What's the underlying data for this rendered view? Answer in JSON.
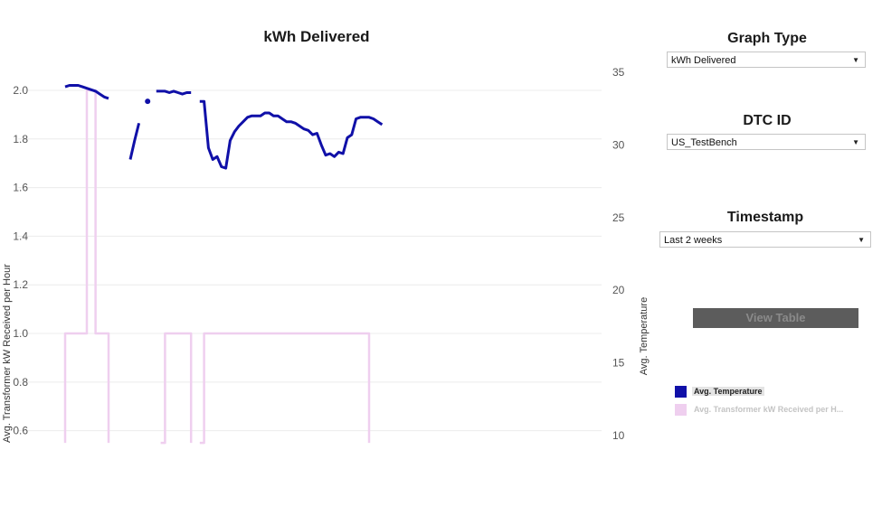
{
  "chart_data": {
    "type": "line",
    "title": "kWh Delivered",
    "ylabel_left": "Avg. Transformer kW Received per Hour",
    "ylabel_right": "Avg. Temperature",
    "y_left_ticks": [
      "2.0",
      "1.8",
      "1.6",
      "1.4",
      "1.2",
      "1.0",
      "0.8",
      "0.6"
    ],
    "y_right_ticks": [
      "35",
      "30",
      "25",
      "20",
      "15",
      "10"
    ],
    "y_left_range": [
      0.58,
      2.0
    ],
    "y_right_range": [
      10,
      35
    ],
    "grid": true,
    "series": [
      {
        "name": "Avg. Transformer kW Received per Hour",
        "axis": "left",
        "color": "#efcfef",
        "segments": [
          [
            [
              0,
              0.55
            ],
            [
              0,
              1.0
            ],
            [
              1,
              1.0
            ],
            [
              2,
              1.0
            ],
            [
              3,
              1.0
            ],
            [
              4,
              1.0
            ],
            [
              5,
              2.0
            ],
            [
              6,
              2.0
            ],
            [
              7,
              1.0
            ],
            [
              8,
              1.0
            ],
            [
              9,
              1.0
            ],
            [
              10,
              0.55
            ]
          ],
          [
            [
              22,
              0.55
            ],
            [
              23,
              1.0
            ],
            [
              24,
              1.0
            ],
            [
              25,
              1.0
            ],
            [
              26,
              1.0
            ],
            [
              27,
              1.0
            ],
            [
              28,
              1.0
            ],
            [
              29,
              0.55
            ]
          ],
          [
            [
              31,
              0.55
            ],
            [
              32,
              1.0
            ],
            [
              33,
              1.0
            ],
            [
              34,
              1.0
            ],
            [
              35,
              1.0
            ],
            [
              36,
              1.0
            ],
            [
              37,
              1.0
            ],
            [
              38,
              1.0
            ],
            [
              39,
              1.0
            ],
            [
              40,
              1.0
            ],
            [
              41,
              1.0
            ],
            [
              42,
              1.0
            ],
            [
              43,
              1.0
            ],
            [
              44,
              1.0
            ],
            [
              45,
              1.0
            ],
            [
              46,
              1.0
            ],
            [
              47,
              1.0
            ],
            [
              48,
              1.0
            ],
            [
              49,
              1.0
            ],
            [
              50,
              1.0
            ],
            [
              51,
              1.0
            ],
            [
              52,
              1.0
            ],
            [
              53,
              1.0
            ],
            [
              54,
              1.0
            ],
            [
              55,
              1.0
            ],
            [
              56,
              1.0
            ],
            [
              57,
              1.0
            ],
            [
              58,
              1.0
            ],
            [
              59,
              1.0
            ],
            [
              60,
              1.0
            ],
            [
              61,
              1.0
            ],
            [
              62,
              1.0
            ],
            [
              63,
              1.0
            ],
            [
              64,
              1.0
            ],
            [
              65,
              1.0
            ],
            [
              66,
              1.0
            ],
            [
              67,
              1.0
            ],
            [
              68,
              1.0
            ],
            [
              69,
              1.0
            ],
            [
              70,
              0.55
            ]
          ]
        ]
      },
      {
        "name": "Avg. Temperature",
        "axis": "right",
        "color": "#1010a8",
        "segments": [
          [
            [
              0,
              34.0
            ],
            [
              1,
              34.1
            ],
            [
              2,
              34.1
            ],
            [
              3,
              34.1
            ],
            [
              4,
              34.0
            ],
            [
              5,
              33.9
            ],
            [
              6,
              33.8
            ],
            [
              7,
              33.7
            ],
            [
              8,
              33.5
            ],
            [
              9,
              33.3
            ],
            [
              10,
              33.2
            ]
          ],
          [
            [
              15,
              29.0
            ],
            [
              16,
              30.3
            ],
            [
              17,
              31.5
            ]
          ],
          [
            [
              19,
              33.0
            ]
          ],
          [
            [
              21,
              33.7
            ],
            [
              22,
              33.7
            ],
            [
              23,
              33.7
            ],
            [
              24,
              33.6
            ],
            [
              25,
              33.7
            ],
            [
              26,
              33.6
            ],
            [
              27,
              33.5
            ],
            [
              28,
              33.6
            ],
            [
              29,
              33.6
            ]
          ],
          [
            [
              31,
              33.0
            ],
            [
              32,
              33.0
            ],
            [
              33,
              29.8
            ],
            [
              34,
              29.0
            ],
            [
              35,
              29.2
            ],
            [
              36,
              28.5
            ],
            [
              37,
              28.4
            ],
            [
              38,
              30.3
            ],
            [
              39,
              30.9
            ],
            [
              40,
              31.3
            ],
            [
              41,
              31.6
            ],
            [
              42,
              31.9
            ],
            [
              43,
              32.0
            ],
            [
              44,
              32.0
            ],
            [
              45,
              32.0
            ],
            [
              46,
              32.2
            ],
            [
              47,
              32.2
            ],
            [
              48,
              32.0
            ],
            [
              49,
              32.0
            ],
            [
              50,
              31.8
            ],
            [
              51,
              31.6
            ],
            [
              52,
              31.6
            ],
            [
              53,
              31.5
            ],
            [
              54,
              31.3
            ],
            [
              55,
              31.1
            ],
            [
              56,
              31.0
            ],
            [
              57,
              30.7
            ],
            [
              58,
              30.8
            ],
            [
              59,
              30.0
            ],
            [
              60,
              29.3
            ],
            [
              61,
              29.4
            ],
            [
              62,
              29.2
            ],
            [
              63,
              29.5
            ],
            [
              64,
              29.4
            ],
            [
              65,
              30.5
            ],
            [
              66,
              30.7
            ],
            [
              67,
              31.8
            ],
            [
              68,
              31.9
            ],
            [
              69,
              31.9
            ],
            [
              70,
              31.9
            ],
            [
              71,
              31.8
            ],
            [
              72,
              31.6
            ],
            [
              73,
              31.4
            ]
          ]
        ]
      }
    ]
  },
  "panel": {
    "graph_type": {
      "heading": "Graph Type",
      "value": "kWh Delivered"
    },
    "dtc_id": {
      "heading": "DTC ID",
      "value": "US_TestBench"
    },
    "timestamp": {
      "heading": "Timestamp",
      "value": "Last 2 weeks"
    },
    "view_table_label": "View Table",
    "caret": "▼"
  },
  "legend": [
    {
      "label": "Avg. Temperature",
      "color": "#1010a8",
      "text_color": "#222222",
      "highlight": "#e4e4e4"
    },
    {
      "label": "Avg. Transformer kW Received per H...",
      "color": "#efcfef",
      "text_color": "#c4c4c4",
      "highlight": "transparent"
    }
  ],
  "colors": {
    "grid": "#ececec",
    "tick_text": "#555555"
  }
}
